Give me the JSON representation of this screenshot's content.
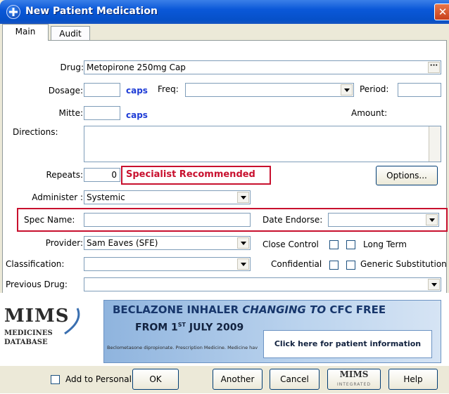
{
  "window": {
    "title": "New Patient Medication",
    "close_glyph": "✕"
  },
  "tabs": [
    {
      "label": "Main"
    },
    {
      "label": "Audit"
    }
  ],
  "form": {
    "drug_label": "Drug:",
    "drug_value": "Metopirone 250mg Cap",
    "dosage_label": "Dosage:",
    "dosage_value": "",
    "dosage_unit": "caps",
    "freq_label": "Freq:",
    "freq_value": "",
    "period_label": "Period:",
    "period_value": "",
    "mitte_label": "Mitte:",
    "mitte_value": "",
    "mitte_unit": "caps",
    "amount_label": "Amount:",
    "directions_label": "Directions:",
    "directions_value": "",
    "repeats_label": "Repeats:",
    "repeats_value": "0",
    "specialist_text": "Specialist Recommended",
    "options_label": "Options...",
    "administer_label": "Administer :",
    "administer_value": "Systemic",
    "spec_name_label": "Spec Name:",
    "spec_name_value": "",
    "date_endorse_label": "Date Endorse:",
    "date_endorse_value": "",
    "provider_label": "Provider:",
    "provider_value": "Sam Eaves (SFE)",
    "close_control_label": "Close Control",
    "long_term_label": "Long Term",
    "classification_label": "Classification:",
    "classification_value": "",
    "confidential_label": "Confidential",
    "generic_label": "Generic Substitution",
    "previous_drug_label": "Previous Drug:",
    "previous_drug_value": ""
  },
  "banner": {
    "logo_line1": "MIMS",
    "logo_line2": "MEDICINES",
    "logo_line3": "DATABASE",
    "headline_a": "BECLAZONE INHALER ",
    "headline_b": "CHANGING TO",
    "headline_c": " CFC FREE",
    "from_text": "FROM 1",
    "from_sup": "ST",
    "from_rest": " JULY 2009",
    "fine_print": "Beclometasone dipropionate. Prescription Medicine. Medicine have benefits and risks.",
    "cta": "Click here for patient information"
  },
  "buttons": {
    "add_personal": "Add to Personal",
    "ok": "OK",
    "another": "Another",
    "cancel": "Cancel",
    "mims": "MIMS",
    "mims_sub": "INTEGRATED",
    "help": "Help"
  }
}
